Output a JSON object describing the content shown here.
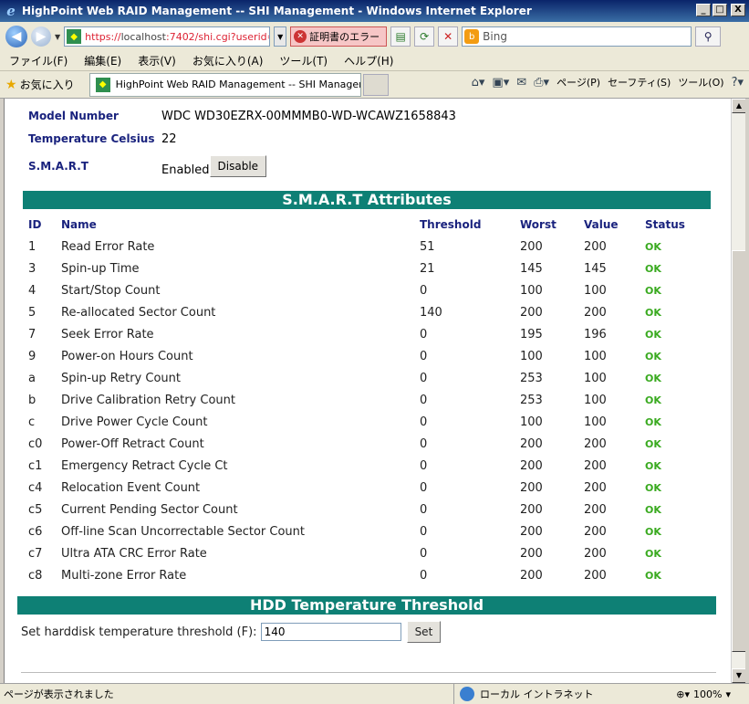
{
  "window": {
    "title": "HighPoint Web RAID Management -- SHI Management - Windows Internet Explorer",
    "minimize": "_",
    "maximize": "□",
    "close": "X"
  },
  "address": {
    "url_prefix": "https://",
    "url_host": "localhost",
    "url_rest": ":7402/shi.cgi?userid=R",
    "cert_error": "証明書のエラー",
    "search_placeholder": "Bing"
  },
  "menu": [
    "ファイル(F)",
    "編集(E)",
    "表示(V)",
    "お気に入り(A)",
    "ツール(T)",
    "ヘルプ(H)"
  ],
  "favbar": {
    "favorites_label": "お気に入り",
    "tab_title": "HighPoint Web RAID Management -- SHI Managem...",
    "page_menu": "ページ(P)",
    "safety_menu": "セーフティ(S)",
    "tools_menu": "ツール(O)"
  },
  "disk_info": {
    "model_label": "Model Number",
    "model_value": "WDC WD30EZRX-00MMMB0-WD-WCAWZ1658843",
    "temp_label": "Temperature Celsius",
    "temp_value": "22",
    "smart_label": "S.M.A.R.T",
    "smart_status": "Enabled",
    "disable_button": "Disable"
  },
  "smart_section": {
    "title": "S.M.A.R.T Attributes",
    "columns": [
      "ID",
      "Name",
      "Threshold",
      "Worst",
      "Value",
      "Status"
    ],
    "rows": [
      [
        "1",
        "Read Error Rate",
        "51",
        "200",
        "200",
        "OK"
      ],
      [
        "3",
        "Spin-up Time",
        "21",
        "145",
        "145",
        "OK"
      ],
      [
        "4",
        "Start/Stop Count",
        "0",
        "100",
        "100",
        "OK"
      ],
      [
        "5",
        "Re-allocated Sector Count",
        "140",
        "200",
        "200",
        "OK"
      ],
      [
        "7",
        "Seek Error Rate",
        "0",
        "195",
        "196",
        "OK"
      ],
      [
        "9",
        "Power-on Hours Count",
        "0",
        "100",
        "100",
        "OK"
      ],
      [
        "a",
        "Spin-up Retry Count",
        "0",
        "253",
        "100",
        "OK"
      ],
      [
        "b",
        "Drive Calibration Retry Count",
        "0",
        "253",
        "100",
        "OK"
      ],
      [
        "c",
        "Drive Power Cycle Count",
        "0",
        "100",
        "100",
        "OK"
      ],
      [
        "c0",
        "Power-Off Retract Count",
        "0",
        "200",
        "200",
        "OK"
      ],
      [
        "c1",
        "Emergency Retract Cycle Ct",
        "0",
        "200",
        "200",
        "OK"
      ],
      [
        "c4",
        "Relocation Event Count",
        "0",
        "200",
        "200",
        "OK"
      ],
      [
        "c5",
        "Current Pending Sector Count",
        "0",
        "200",
        "200",
        "OK"
      ],
      [
        "c6",
        "Off-line Scan Uncorrectable Sector Count",
        "0",
        "200",
        "200",
        "OK"
      ],
      [
        "c7",
        "Ultra ATA CRC Error Rate",
        "0",
        "200",
        "200",
        "OK"
      ],
      [
        "c8",
        "Multi-zone Error Rate",
        "0",
        "200",
        "200",
        "OK"
      ]
    ]
  },
  "temp_threshold": {
    "title": "HDD Temperature Threshold",
    "label": "Set harddisk temperature threshold (F):",
    "value": "140",
    "set_button": "Set"
  },
  "statusbar": {
    "text": "ページが表示されました",
    "zone": "ローカル イントラネット",
    "zoom": "100%"
  },
  "colors": {
    "section_header": "#0e8075",
    "label_blue": "#1a237e",
    "ok_green": "#3aaa20"
  }
}
